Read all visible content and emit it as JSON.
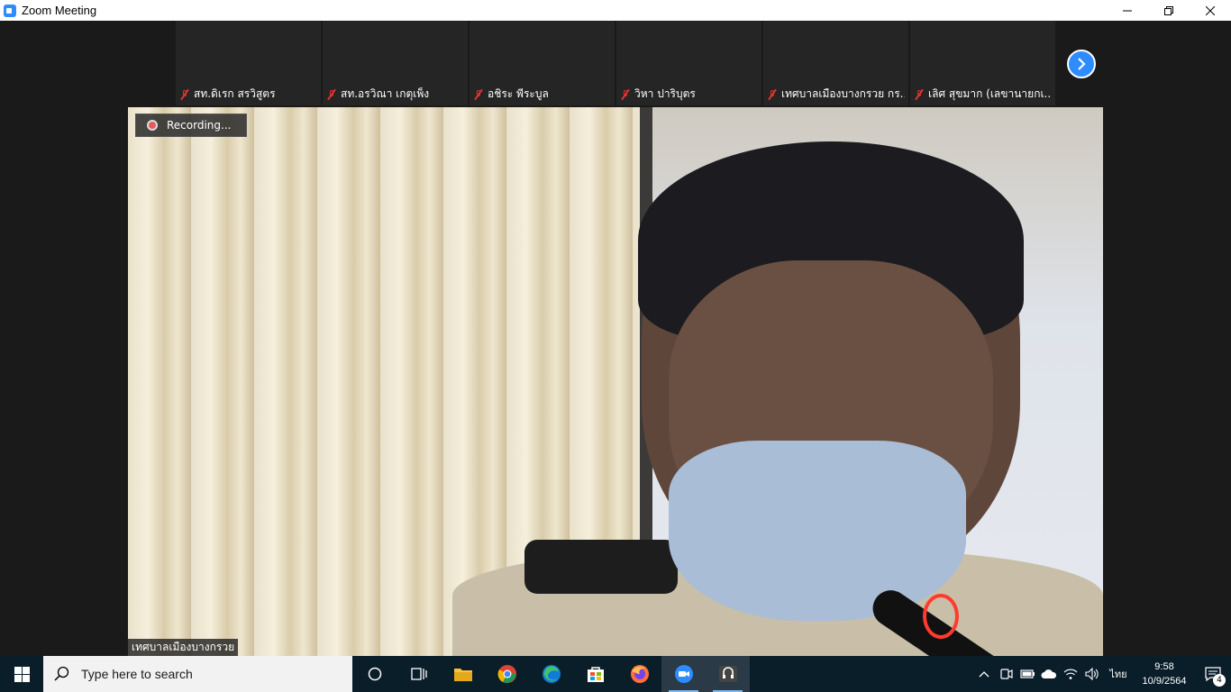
{
  "window": {
    "title": "Zoom Meeting",
    "minimize_icon": "minimize-icon",
    "restore_icon": "restore-icon",
    "close_icon": "close-icon"
  },
  "participants": [
    {
      "name": "สท.ดิเรก สรวิสูตร",
      "muted": true
    },
    {
      "name": "สท.อรวิณา เกตุเพ็ง",
      "muted": true
    },
    {
      "name": "อชิระ พีระบูล",
      "muted": true
    },
    {
      "name": "วิหา ปาริบุตร",
      "muted": true
    },
    {
      "name": "เทศบาลเมืองบางกรวย กร...",
      "muted": true
    },
    {
      "name": "เลิศ สุขมาก (เลขานายกเ...",
      "muted": true
    }
  ],
  "main_video": {
    "recording_label": "Recording...",
    "speaker_name": "เทศบาลเมืองบางกรวย"
  },
  "taskbar": {
    "search_placeholder": "Type here to search",
    "apps": [
      "cortana-icon",
      "task-view-icon",
      "file-explorer-icon",
      "chrome-icon",
      "edge-icon",
      "store-icon",
      "firefox-icon",
      "zoom-icon",
      "obs-icon"
    ],
    "language": "ไทย",
    "time": "9:58",
    "date": "10/9/2564",
    "notification_count": "4"
  },
  "colors": {
    "accent": "#2d8cff",
    "muted_red": "#e0332e",
    "taskbar": "#0a1e2a"
  }
}
